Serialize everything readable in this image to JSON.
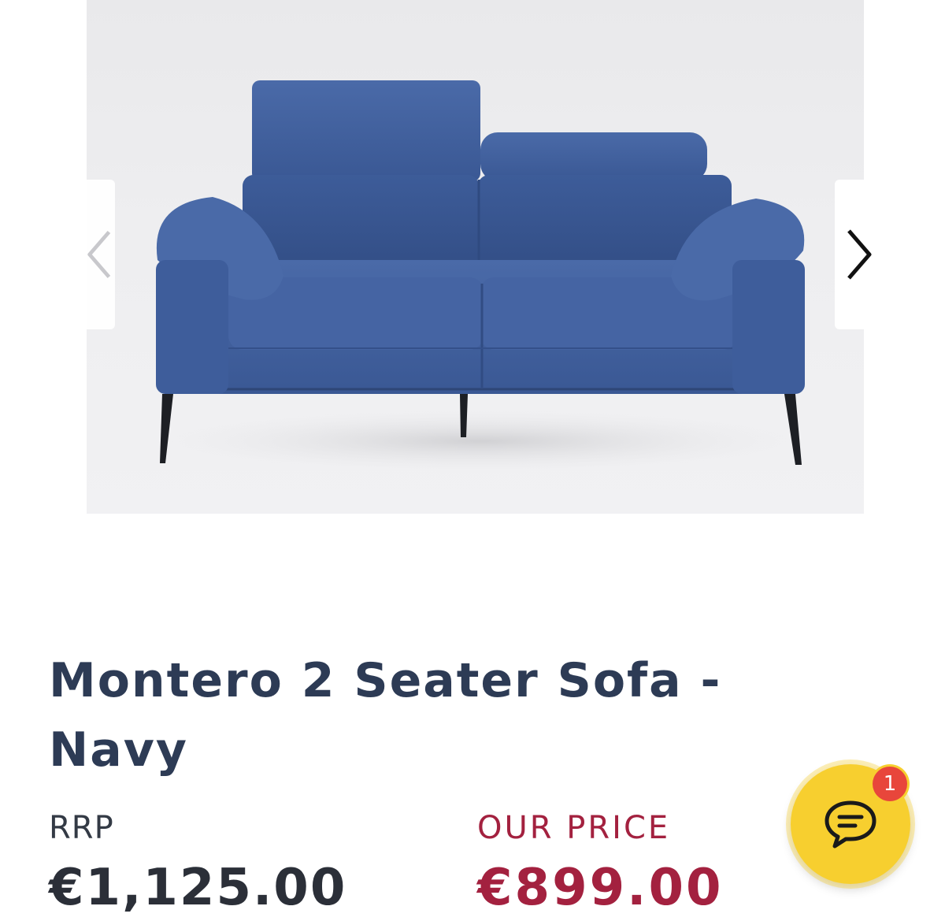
{
  "product": {
    "title": "Montero 2 Seater Sofa - Navy",
    "image_alt": "Montero 2 Seater Sofa - Navy product photo"
  },
  "gallery": {
    "prev_icon": "chevron-left-icon",
    "next_icon": "chevron-right-icon"
  },
  "pricing": {
    "rrp_label": "RRP",
    "rrp_value": "€1,125.00",
    "our_price_label": "OUR PRICE",
    "our_price_value": "€899.00"
  },
  "chat": {
    "icon": "chat-bubble-icon",
    "badge_count": "1"
  },
  "colors": {
    "title": "#2d3b55",
    "price_accent": "#a3213f",
    "chat_button": "#f7cf2f",
    "badge": "#e8463b",
    "sofa": "#3f5f9e"
  }
}
